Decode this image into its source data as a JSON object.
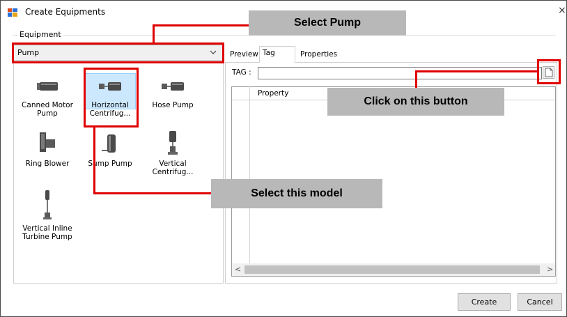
{
  "window": {
    "title": "Create Equipments",
    "close_glyph": "×"
  },
  "equipment_group": {
    "label": "Equipment"
  },
  "category_combo": {
    "value": "Pump"
  },
  "equipment_items": [
    {
      "label": "Canned Motor Pump",
      "icon": "canned-motor-pump-icon"
    },
    {
      "label": "Horizontal Centrifug...",
      "icon": "horizontal-centrifugal-pump-icon",
      "selected": true
    },
    {
      "label": "Hose Pump",
      "icon": "hose-pump-icon"
    },
    {
      "label": "Ring Blower",
      "icon": "ring-blower-icon"
    },
    {
      "label": "Sump Pump",
      "icon": "sump-pump-icon"
    },
    {
      "label": "Vertical Centrifug...",
      "icon": "vertical-centrifugal-pump-icon"
    },
    {
      "label": "Vertical Inline Turbine Pump",
      "icon": "vertical-inline-turbine-pump-icon"
    }
  ],
  "tabs": [
    {
      "label": "Preview"
    },
    {
      "label": "Tag",
      "active": true
    },
    {
      "label": "Properties"
    }
  ],
  "tag_field": {
    "label": "TAG :",
    "value": ""
  },
  "grid": {
    "header": "Property"
  },
  "buttons": {
    "create": "Create",
    "cancel": "Cancel"
  },
  "annotations": {
    "select_pump": "Select Pump",
    "click_button": "Click on this button",
    "select_model": "Select this model"
  },
  "colors": {
    "highlight": "#e00000",
    "callout_bg": "#b8b8b8",
    "selection": "#cce8ff"
  }
}
